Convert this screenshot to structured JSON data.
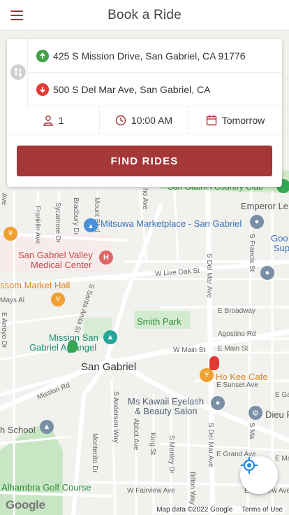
{
  "header": {
    "title": "Book a Ride",
    "menu_icon": "hamburger-menu-icon",
    "accent_color": "#9e3535"
  },
  "ride_form": {
    "pickup": {
      "address": "425 S Mission Drive, San Gabriel, CA 91776",
      "icon": "pickup-arrow-up-icon",
      "color": "#43a047"
    },
    "dropoff": {
      "address": "500 S Del Mar Ave, San Gabriel, CA",
      "icon": "dropoff-arrow-down-icon",
      "color": "#e53935"
    },
    "swap_icon": "swap-vertical-icon",
    "passengers": {
      "value": "1",
      "icon": "person-icon"
    },
    "time": {
      "value": "10:00 AM",
      "icon": "clock-icon"
    },
    "date": {
      "value": "Tomorrow",
      "icon": "calendar-icon"
    },
    "find_button": "FIND RIDES",
    "button_color": "#a43737"
  },
  "map": {
    "places": {
      "mitsuwa": "Mitsuwa Marketplace - San Gabriel",
      "hospital_1": "San Gabriel Valley",
      "hospital_2": "Medical Center",
      "blossom": "ssom Market Hall",
      "mission_1": "Mission San",
      "mission_2": "Gabriel Arcángel",
      "smith_park": "Smith Park",
      "san_gabriel": "San Gabriel",
      "ho_kee": "Ho Kee Cafe",
      "ms_kawaii_1": "Ms Kawaii Eyelash",
      "ms_kawaii_2": "& Beauty Salon",
      "emperor": "Emperor Le",
      "country_club": "San Gabriel Country Club",
      "good_sup_1": "Goo",
      "good_sup_2": "Sup",
      "dieu": "Dieu F",
      "school": "h School",
      "golf": "Alhambra Golf Course"
    },
    "streets": {
      "del_mar_1": "S Del Mar Ave",
      "del_mar_2": "S Del Mar Ave",
      "live_oak": "W Live Oak St",
      "broadway": "E Broadway",
      "agostino": "Agostino Rd",
      "w_main": "W Main St",
      "e_main": "E Main St",
      "e_sunset": "E Sunset Ave",
      "mission_rd": "Mission Rd",
      "santa_anita": "S Santa Anita St",
      "anderson": "S Anderson Way",
      "abbot": "Abbot Ave",
      "king": "King St",
      "manley": "S Manley Dr",
      "bilton": "Bilton Way",
      "montecito": "Montecito Dr",
      "francis": "S Francis St",
      "e_grand": "E Grand Ave",
      "w_fairview": "W Fairview Ave",
      "e_fairview": "E Fairview Ave",
      "franklin": "Franklin Ave",
      "sycamore": "Sycamore Dr",
      "bradbury": "Bradbury Dr",
      "mount": "Mount Blvd",
      "mays": "Mays Al",
      "arroyo": "E Arroyo Dr",
      "ho_ave": "ho Ave",
      "ave": "Ave",
      "e_ga": "E Ga",
      "e_ma": "E Ma",
      "s_ma": "S Ma"
    },
    "google_logo": "Google",
    "attribution": "Map data ©2022 Google",
    "terms": "Terms of Use",
    "locate_icon": "my-location-icon"
  }
}
